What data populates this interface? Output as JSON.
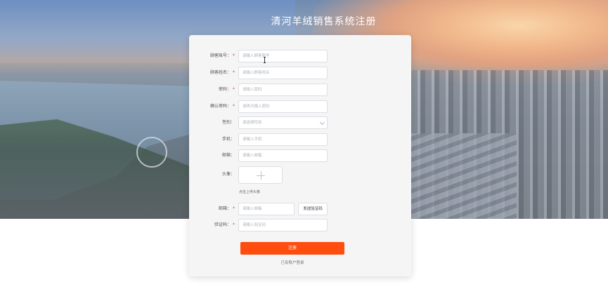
{
  "page": {
    "title": "清河羊绒销售系统注册"
  },
  "form": {
    "fields": [
      {
        "label": "顾客账号：",
        "placeholder": "请输入顾客账号",
        "required": true
      },
      {
        "label": "顾客姓名：",
        "placeholder": "请输入顾客姓名",
        "required": true
      },
      {
        "label": "密码：",
        "placeholder": "请输入密码",
        "required": true
      },
      {
        "label": "确认密码：",
        "placeholder": "请再次输入密码",
        "required": true
      },
      {
        "label": "性别：",
        "placeholder": "请选择性别",
        "required": false
      },
      {
        "label": "手机：",
        "placeholder": "请输入手机",
        "required": false
      },
      {
        "label": "邮箱：",
        "placeholder": "请输入邮箱",
        "required": false
      }
    ],
    "avatar": {
      "label": "头像：",
      "hint": "点击上传头像"
    },
    "email_verify": {
      "label": "邮箱：",
      "placeholder": "请输入邮箱",
      "required": true,
      "button_label": "发送验证码"
    },
    "code": {
      "label": "验证码：",
      "placeholder": "请输入验证码",
      "required": true
    },
    "required_mark": "*",
    "submit_label": "注册",
    "login_link": "已有账户登录"
  },
  "colors": {
    "accent": "#ff4d0f",
    "required": "#e53935"
  }
}
